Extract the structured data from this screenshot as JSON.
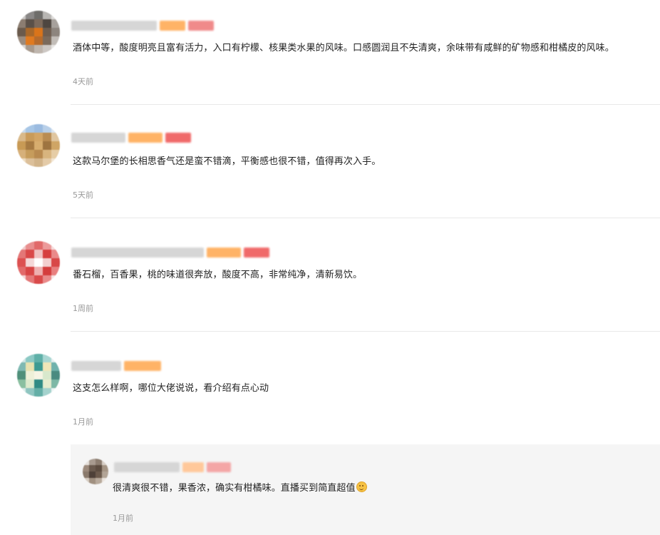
{
  "comments": [
    {
      "text": "酒体中等，酸度明亮且富有活力，入口有柠檬、核果类水果的风味。口感圆润且不失清爽，余味带有咸鲜的矿物感和柑橘皮的风味。",
      "time": "4天前"
    },
    {
      "text": "这款马尔堡的长相思香气还是蛮不错滴，平衡感也很不错，值得再次入手。",
      "time": "5天前"
    },
    {
      "text": "番石榴，百香果，桃的味道很奔放，酸度不高，非常纯净，清新易饮。",
      "time": "1周前"
    },
    {
      "text": "这支怎么样啊，哪位大佬说说，看介绍有点心动",
      "time": "1月前",
      "reply": {
        "text": "很清爽很不错，果香浓，确实有柑橘味。直播买到简直超值",
        "emoji_icon": "smiling-face-emoji",
        "time": "1月前"
      }
    }
  ],
  "colors": {
    "text": "#222222",
    "time": "#999999",
    "divider": "#e8e8e8",
    "reply_bg": "#f5f5f5",
    "badge_orange": "#ffb366",
    "badge_red": "#f06a6a"
  }
}
